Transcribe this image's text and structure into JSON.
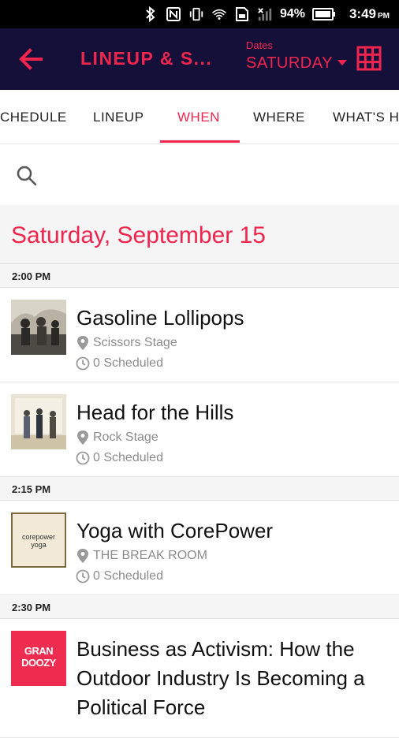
{
  "status_bar": {
    "battery_percent": "94%",
    "time": "3:49",
    "ampm": "PM",
    "icons": [
      "bluetooth-icon",
      "nfc-icon",
      "vibrate-icon",
      "wifi-icon",
      "sim-icon",
      "signal-icon",
      "battery-icon"
    ]
  },
  "app_bar": {
    "title": "LINEUP & S...",
    "dates_label": "Dates",
    "dates_value": "SATURDAY",
    "accent_color": "#f0254e",
    "background_color": "#15103a"
  },
  "tabs": [
    {
      "label": "CHEDULE",
      "active": false
    },
    {
      "label": "LINEUP",
      "active": false
    },
    {
      "label": "WHEN",
      "active": true
    },
    {
      "label": "WHERE",
      "active": false
    },
    {
      "label": "WHAT'S H",
      "active": false
    }
  ],
  "search": {
    "placeholder": ""
  },
  "schedule": {
    "day_title": "Saturday, September 15",
    "groups": [
      {
        "time": "2:00 PM",
        "events": [
          {
            "title": "Gasoline Lollipops",
            "stage": "Scissors Stage",
            "scheduled": "0 Scheduled"
          },
          {
            "title": "Head for the Hills",
            "stage": "Rock Stage",
            "scheduled": "0 Scheduled"
          }
        ]
      },
      {
        "time": "2:15 PM",
        "events": [
          {
            "title": "Yoga with CorePower",
            "stage": "THE BREAK ROOM",
            "scheduled": "0 Scheduled",
            "thumb_text": "corepower yoga"
          }
        ]
      },
      {
        "time": "2:30 PM",
        "events": [
          {
            "title": "Business as Activism: How the Outdoor Industry Is Becoming a Political Force",
            "thumb_text_1": "GRAN",
            "thumb_text_2": "DOOZY"
          }
        ]
      }
    ]
  }
}
